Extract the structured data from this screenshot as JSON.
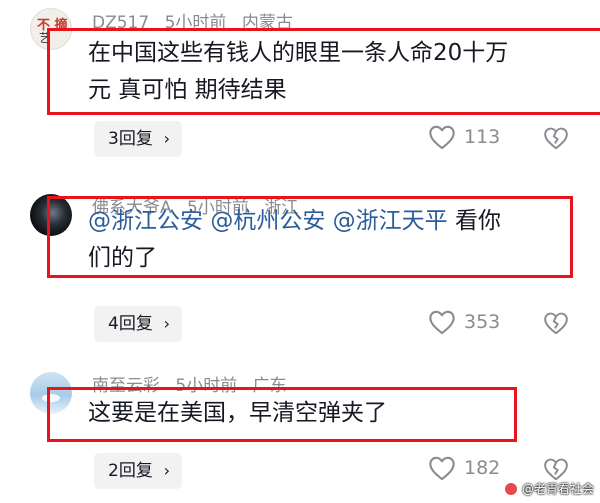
{
  "comments": [
    {
      "avatar": {
        "line1": "不 摘",
        "line2": "艺"
      },
      "username": "DZ517",
      "time": "5小时前",
      "location": "内蒙古",
      "content_line1": "在中国这些有钱人的眼里一条人命20十万",
      "content_line2": "元 真可怕 期待结果",
      "replies": "3回复",
      "likes": "113"
    },
    {
      "username": "佛系大爷A",
      "time": "5小时前",
      "location": "浙江",
      "mentions": [
        "@浙江公安",
        "@杭州公安",
        "@浙江天平"
      ],
      "content_tail": "看你",
      "content_line2": "们的了",
      "replies": "4回复",
      "likes": "353"
    },
    {
      "username": "南至云彩",
      "time": "5小时前",
      "location": "广东",
      "content_line1": "这要是在美国，早清空弹夹了",
      "replies": "2回复",
      "likes": "182"
    }
  ],
  "icons": {
    "like": "heart-outline-icon",
    "dislike": "broken-heart-icon",
    "chevron": "chevron-right-icon"
  },
  "colors": {
    "highlight_box": "#e8141c",
    "mention": "#2a5d9a",
    "meta": "#8a8b91"
  },
  "watermark": "@老胃看社会"
}
